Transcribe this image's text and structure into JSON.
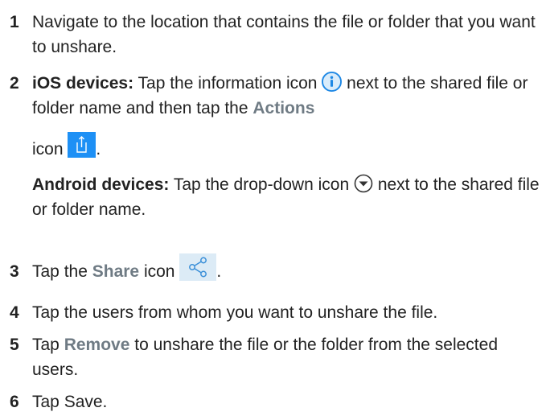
{
  "steps": [
    {
      "num": "1",
      "text": "Navigate to the location that contains the file or folder that you want to unshare."
    },
    {
      "num": "2",
      "ios_label": "iOS devices:",
      "ios_text_a": " Tap the information icon ",
      "ios_text_b": " next to the shared file or folder name and then tap the ",
      "ios_actions": "Actions",
      "ios_icon_word": "icon ",
      "ios_period": ".",
      "android_label": "Android devices:",
      "android_text_a": " Tap the drop-down icon ",
      "android_text_b": " next to the shared file or folder name."
    },
    {
      "num": "3",
      "text_a": "Tap the ",
      "ui": "Share",
      "text_b": " icon ",
      "period": "."
    },
    {
      "num": "4",
      "text": "Tap the users from whom you want to unshare the file."
    },
    {
      "num": "5",
      "text_a": "Tap ",
      "ui": "Remove",
      "text_b": " to unshare the file or the folder from the selected users."
    },
    {
      "num": "6",
      "text": "Tap Save."
    }
  ],
  "colors": {
    "info_icon": "#1e88e5",
    "actions_icon_bg": "#1e90f5",
    "share_icon_bg": "#dcebf6",
    "share_icon_stroke": "#3a8fd8",
    "ui_label": "#6f7b84"
  }
}
